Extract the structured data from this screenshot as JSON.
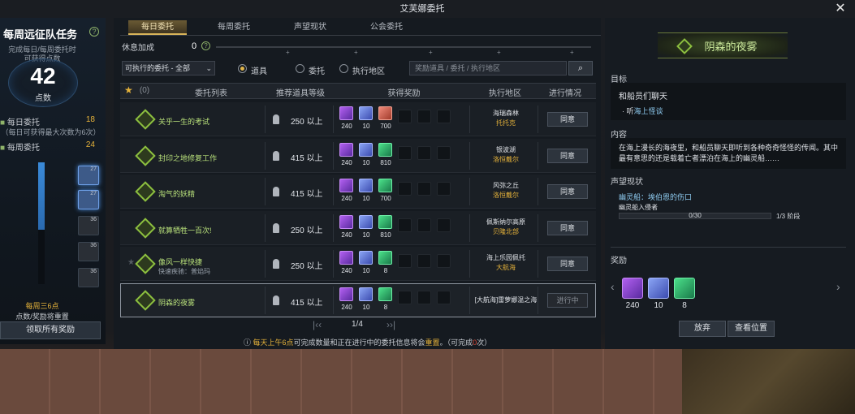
{
  "window": {
    "title": "艾芙娜委托",
    "close": "✕"
  },
  "left": {
    "title": "每周远征队任务",
    "help": "?",
    "sub1": "完成每日/每周委托时",
    "sub2": "可获得点数",
    "points": "42",
    "points_unit": "点数",
    "daily_label": "每日委托",
    "daily_value": "18",
    "daily_note": "（每日可获得最大次数为6次）",
    "weekly_label": "每周委托",
    "weekly_value": "24",
    "progress": 0.55,
    "milestones": [
      "27",
      "27",
      "36",
      "36",
      "36",
      "54"
    ],
    "note_a": "每周三6点",
    "note_b": "点数/奖励将重置",
    "claim_button": "领取所有奖励"
  },
  "tabs": [
    "每日委托",
    "每周委托",
    "声望现状",
    "公会委托"
  ],
  "rest": {
    "label": "休息加成",
    "value": "0",
    "help": "?"
  },
  "filter": {
    "select": "可执行的委托 - 全部",
    "radios": [
      "道具",
      "委托",
      "执行地区"
    ],
    "search_placeholder": "奖励道具 / 委托 / 执行地区",
    "search_icon": "magnifier-icon"
  },
  "table": {
    "headers": [
      "(0)",
      "委托列表",
      "推荐道具等级",
      "获得奖励",
      "执行地区",
      "进行情况"
    ],
    "rows": [
      {
        "name": "关乎一生的考试",
        "sub": "",
        "level": "250 以上",
        "rewards": [
          {
            "t": "p",
            "c": "240"
          },
          {
            "t": "b",
            "c": "10"
          },
          {
            "t": "r",
            "c": "700"
          }
        ],
        "loc1": "海瑞森林",
        "loc2": "托托克",
        "action": "同意"
      },
      {
        "name": "封印之地修复工作",
        "sub": "",
        "level": "415 以上",
        "rewards": [
          {
            "t": "p",
            "c": "240"
          },
          {
            "t": "b",
            "c": "10"
          },
          {
            "t": "g",
            "c": "810"
          }
        ],
        "loc1": "银波湖",
        "loc2": "洛恒戴尔",
        "action": "同意"
      },
      {
        "name": "淘气的妖精",
        "sub": "",
        "level": "415 以上",
        "rewards": [
          {
            "t": "p",
            "c": "240"
          },
          {
            "t": "b",
            "c": "10"
          },
          {
            "t": "g",
            "c": "700"
          }
        ],
        "loc1": "风弥之丘",
        "loc2": "洛恒戴尔",
        "action": "同意"
      },
      {
        "name": "就算牺牲一百次!",
        "sub": "",
        "level": "250 以上",
        "rewards": [
          {
            "t": "p",
            "c": "240"
          },
          {
            "t": "b",
            "c": "10"
          },
          {
            "t": "g",
            "c": "810"
          }
        ],
        "loc1": "佩斯纳尔高原",
        "loc2": "贝隆北部",
        "action": "同意"
      },
      {
        "name": "像风一样快捷",
        "sub": "快速疾驰：普焰玛",
        "level": "250 以上",
        "rewards": [
          {
            "t": "p",
            "c": "240"
          },
          {
            "t": "b",
            "c": "10"
          },
          {
            "t": "g",
            "c": "8"
          }
        ],
        "loc1": "海上乐园佩托",
        "loc2": "大航海",
        "action": "同意"
      },
      {
        "name": "阴森的夜雾",
        "sub": "",
        "level": "415 以上",
        "rewards": [
          {
            "t": "p",
            "c": "240"
          },
          {
            "t": "b",
            "c": "10"
          },
          {
            "t": "g",
            "c": "8"
          }
        ],
        "loc1": "[大航海]雷萝娜温之海",
        "loc2": "",
        "action": "进行中"
      }
    ]
  },
  "pager": {
    "text": "1/4"
  },
  "notice": {
    "pre": "每天上午6点",
    "mid": "可完成数量和正在进行中的委托信息将会",
    "red": "重置",
    "post": "。（可完成",
    "n": "0",
    "end": "次）"
  },
  "detail": {
    "title": "阴森的夜雾",
    "target_label": "目标",
    "target_main": "和船员们聊天",
    "target_sub_prefix": "· 听",
    "target_sub": "海上怪谈",
    "content_label": "内容",
    "content": "在海上漫长的海夜里，和船员聊天即听到各种奇奇怪怪的传闻。其中最有意思的还是载着亡者漂泊在海上的幽灵船……",
    "rep_label": "声望现状",
    "rep_name": "幽灵船：埃伯恩的伤口",
    "rep_sub": "幽灵船入侵者",
    "rep_value": "0/30",
    "rep_stage": "1/3 阶段",
    "reward_label": "奖励",
    "rewards": [
      {
        "t": "p",
        "c": "240"
      },
      {
        "t": "b",
        "c": "10"
      },
      {
        "t": "g",
        "c": "8"
      }
    ],
    "give_up": "放弃",
    "view_location": "查看位置"
  }
}
